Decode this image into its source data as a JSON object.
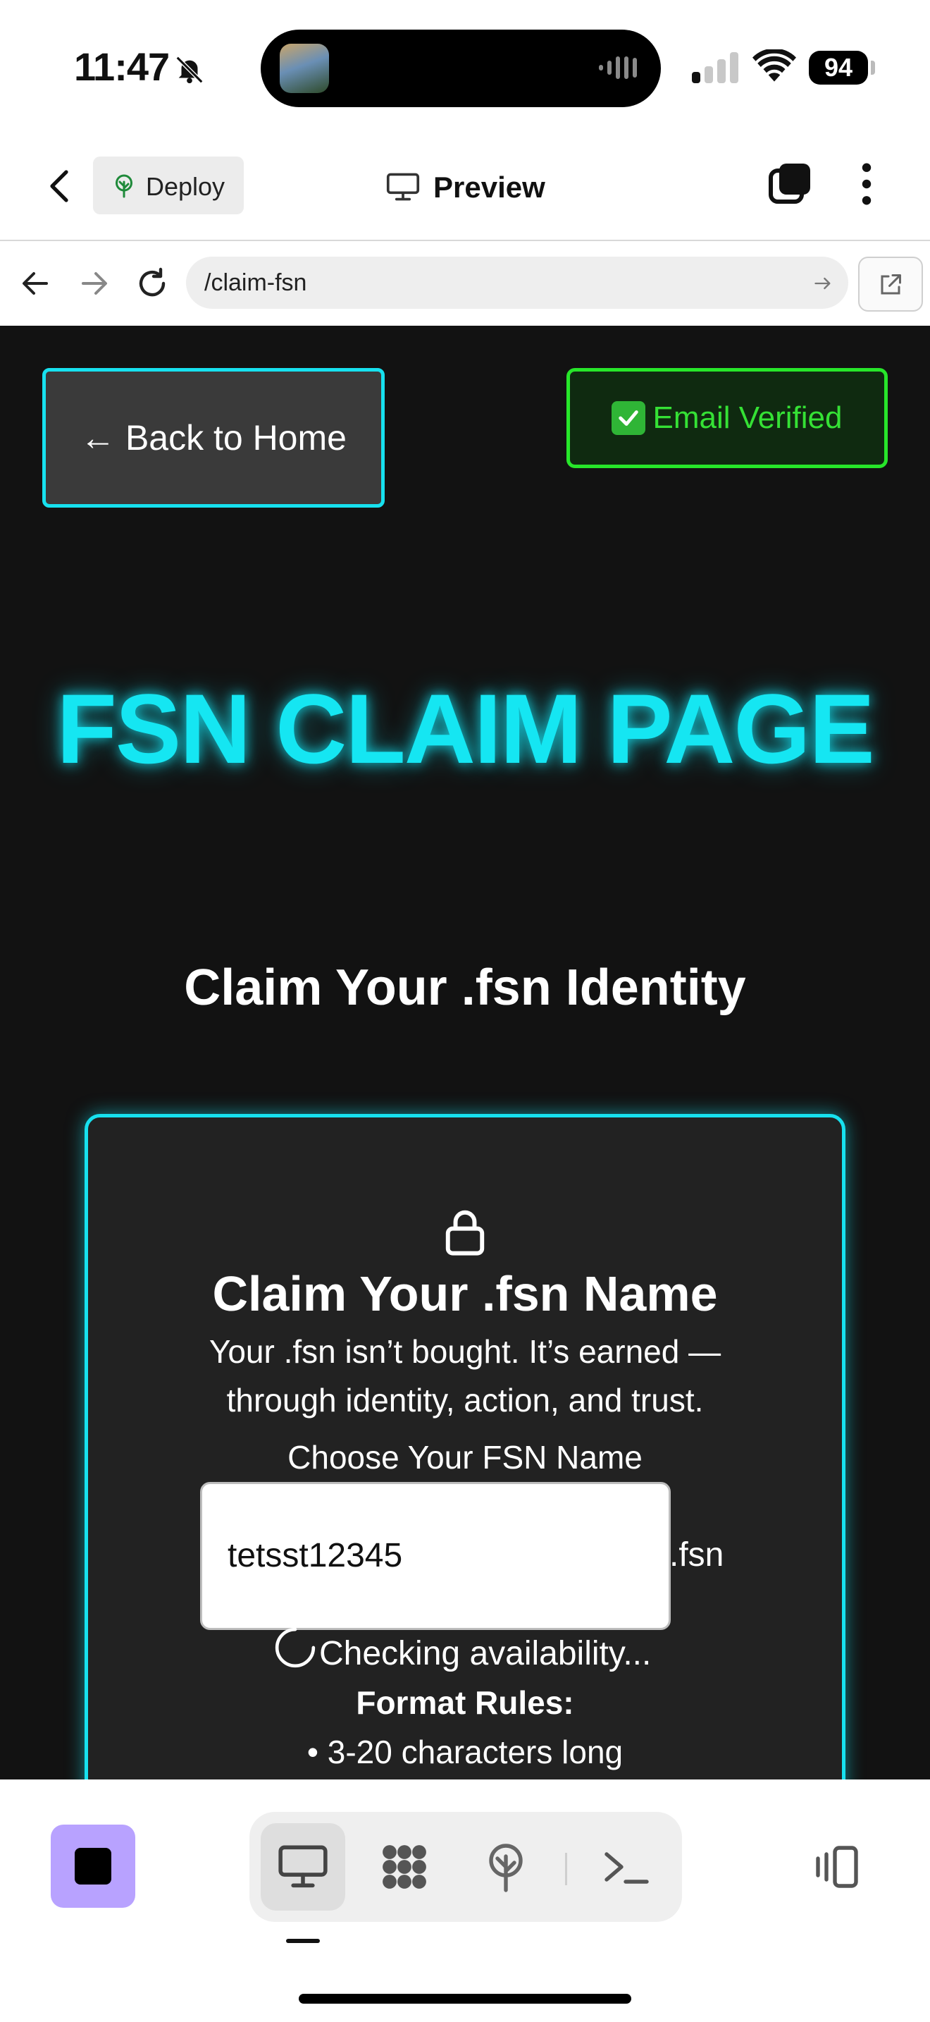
{
  "status_bar": {
    "time": "11:47",
    "battery": "94",
    "icons": [
      "bell-muted-icon",
      "audio-wave-icon",
      "signal-icon",
      "wifi-icon",
      "battery-icon"
    ]
  },
  "app_header": {
    "deploy_label": "Deploy",
    "preview_label": "Preview",
    "icons": [
      "chevron-left-icon",
      "deploy-tree-icon",
      "monitor-icon",
      "tabs-icon",
      "more-vertical-icon"
    ]
  },
  "url_bar": {
    "url": "/claim-fsn",
    "icons": [
      "arrow-left-icon",
      "arrow-right-icon",
      "reload-icon",
      "go-arrow-icon",
      "external-link-icon"
    ]
  },
  "page": {
    "back_button": "← Back to Home",
    "verified_badge": "Email Verified",
    "title": "FSN CLAIM PAGE",
    "subtitle": "Claim Your .fsn Identity",
    "card": {
      "title": "Claim Your .fsn Name",
      "description": "Your .fsn isn’t bought. It’s earned — through identity, action, and trust.",
      "input_label": "Choose Your FSN Name",
      "input_value": "tetsst12345",
      "suffix": ".fsn",
      "status": "Checking availability...",
      "rules_heading": "Format Rules:",
      "rules": [
        "• 3-20 characters long"
      ]
    },
    "colors": {
      "accent": "#17e1ef",
      "verified": "#27e62a",
      "background": "#121212",
      "card": "#222222"
    }
  },
  "bottom_toolbar": {
    "icons": [
      "stop-icon",
      "desktop-icon",
      "integrations-icon",
      "deploy-icon",
      "terminal-icon",
      "layout-toggle-icon"
    ]
  }
}
